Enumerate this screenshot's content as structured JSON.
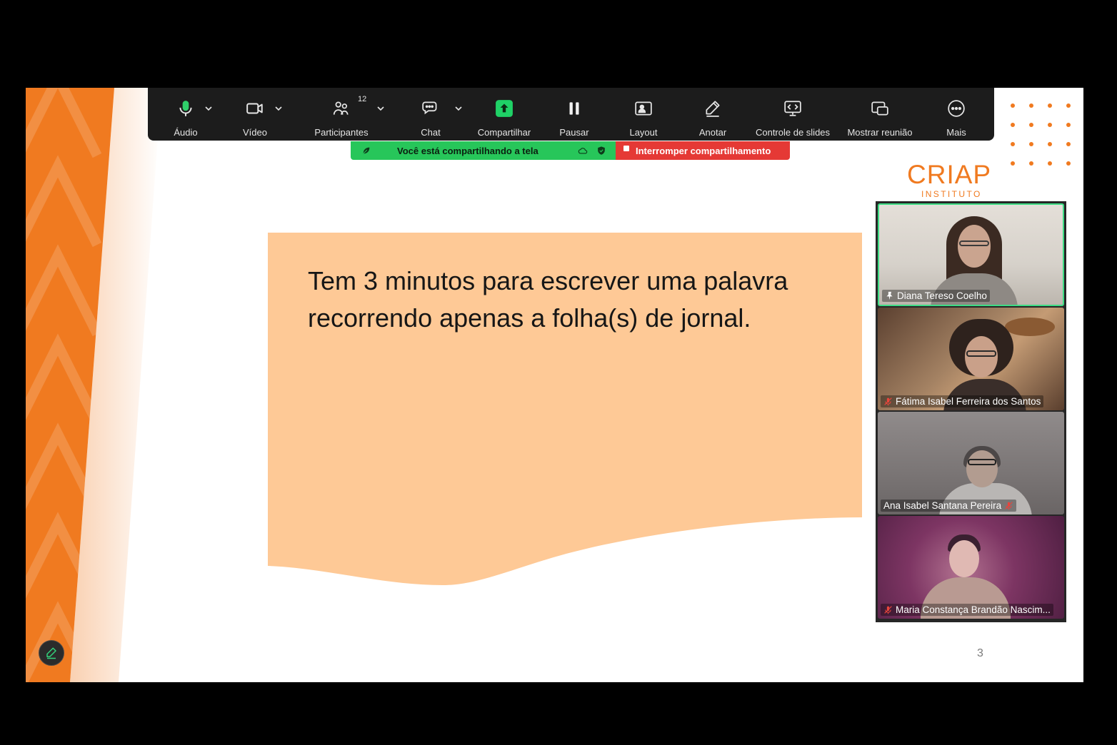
{
  "toolbar": {
    "items": [
      {
        "label": "Áudio",
        "icon": "microphone-icon"
      },
      {
        "label": "Vídeo",
        "icon": "video-camera-icon"
      },
      {
        "label": "Participantes",
        "icon": "participants-icon"
      },
      {
        "label": "Chat",
        "icon": "chat-icon"
      },
      {
        "label": "Compartilhar",
        "icon": "share-screen-icon"
      },
      {
        "label": "Pausar",
        "icon": "pause-icon"
      },
      {
        "label": "Layout",
        "icon": "layout-icon"
      },
      {
        "label": "Anotar",
        "icon": "pencil-icon"
      },
      {
        "label": "Controle de slides",
        "icon": "slide-control-icon"
      },
      {
        "label": "Mostrar reunião",
        "icon": "show-meeting-icon"
      },
      {
        "label": "Mais",
        "icon": "more-icon"
      }
    ],
    "participants_count": "12"
  },
  "share_status": {
    "message": "Você está compartilhando a tela",
    "stop_label": "Interromper compartilhamento"
  },
  "slide": {
    "text_lines": [
      "Tem 3 minutos para escrever uma palavra",
      "recorrendo apenas a folha(s) de jornal."
    ],
    "page_number": "3",
    "logo": {
      "name": "CRIAP",
      "subtitle": "INSTITUTO"
    }
  },
  "participants": [
    {
      "name": "Diana Tereso Coelho",
      "pinned": true,
      "muted": false,
      "active_speaker": true
    },
    {
      "name": "Fátima Isabel Ferreira dos Santos",
      "pinned": false,
      "muted": true,
      "active_speaker": false
    },
    {
      "name": "Ana Isabel Santana Pereira",
      "pinned": false,
      "muted": true,
      "active_speaker": false
    },
    {
      "name": "Maria Constança Brandão Nascim...",
      "pinned": false,
      "muted": true,
      "active_speaker": false
    }
  ],
  "colors": {
    "accent_orange": "#f07a20",
    "slide_box": "#fec996",
    "share_green": "#27c65a",
    "stop_red": "#e53935",
    "toolbar_bg": "#1c1c1c",
    "active_speaker_border": "#3ddc84"
  }
}
